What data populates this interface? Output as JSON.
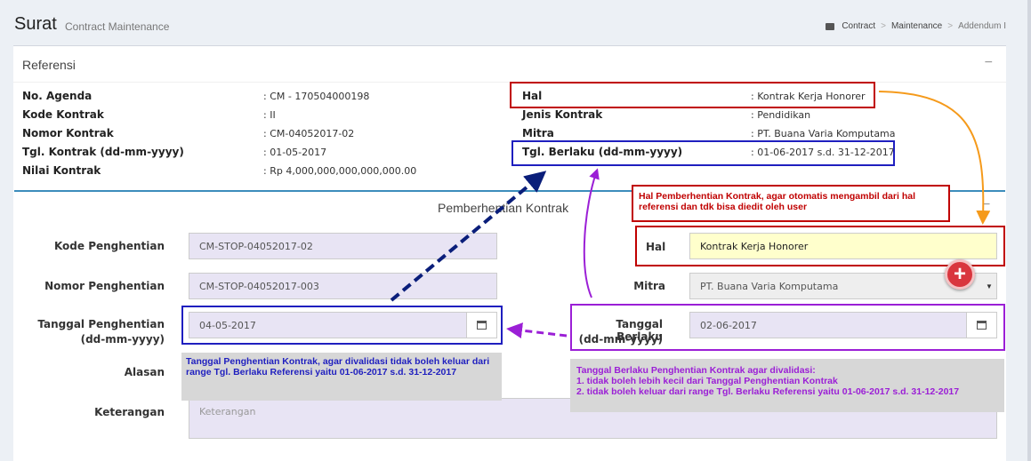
{
  "header": {
    "title": "Surat",
    "subtitle": "Contract Maintenance",
    "breadcrumb": [
      "Contract",
      "Maintenance",
      "Addendum I"
    ]
  },
  "referensi": {
    "title": "Referensi",
    "collapse": "−",
    "left": [
      {
        "label": "No. Agenda",
        "value": ": CM - 170504000198"
      },
      {
        "label": "Kode Kontrak",
        "value": ": II"
      },
      {
        "label": "Nomor Kontrak",
        "value": ": CM-04052017-02"
      },
      {
        "label": "Tgl. Kontrak (dd-mm-yyyy)",
        "value": ": 01-05-2017"
      },
      {
        "label": "Nilai Kontrak",
        "value": ": Rp 4,000,000,000,000,000.00"
      }
    ],
    "right": [
      {
        "label": "Hal",
        "value": ": Kontrak Kerja Honorer"
      },
      {
        "label": "Jenis Kontrak",
        "value": ": Pendidikan"
      },
      {
        "label": "Mitra",
        "value": ": PT. Buana Varia Komputama"
      },
      {
        "label": "Tgl. Berlaku (dd-mm-yyyy)",
        "value": ": 01-06-2017 s.d. 31-12-2017"
      }
    ]
  },
  "pemberhentian": {
    "title": "Pemberhentian Kontrak",
    "collapse": "−",
    "kode_label": "Kode Penghentian",
    "kode_value": "CM-STOP-04052017-02",
    "nomor_label": "Nomor Penghentian",
    "nomor_value": "CM-STOP-04052017-003",
    "tanggal_label_1": "Tanggal Penghentian",
    "tanggal_label_2": "(dd-mm-yyyy)",
    "tanggal_value": "04-05-2017",
    "alasan_label": "Alasan",
    "keterangan_label": "Keterangan",
    "keterangan_placeholder": "Keterangan",
    "hal_label": "Hal",
    "hal_value": "Kontrak Kerja Honorer",
    "mitra_label": "Mitra",
    "mitra_value": "PT. Buana Varia Komputama",
    "berlaku_label_1": "Tanggal Berlaku",
    "berlaku_label_2": "(dd-mm-yyyy)",
    "berlaku_value": "02-06-2017",
    "plus": "+"
  },
  "annotations": {
    "hal_note": "Hal Pemberhentian Kontrak, agar otomatis mengambil dari hal referensi dan tdk bisa diedit oleh user",
    "tanggal_note": "Tanggal Penghentian Kontrak, agar divalidasi tidak boleh keluar dari range Tgl. Berlaku Referensi yaitu 01-06-2017 s.d. 31-12-2017",
    "berlaku_note_1": "Tanggal Berlaku Penghentian Kontrak agar divalidasi:",
    "berlaku_note_2": "1. tidak boleh lebih kecil dari Tanggal Penghentian Kontrak",
    "berlaku_note_3": "2. tidak boleh keluar dari range Tgl. Berlaku Referensi yaitu 01-06-2017 s.d. 31-12-2017",
    "colors": {
      "red": "#c00000",
      "blue": "#1f1fbf",
      "purple": "#9b1fd6",
      "orange": "#f59a1b",
      "navy": "#0a1e7a"
    }
  }
}
